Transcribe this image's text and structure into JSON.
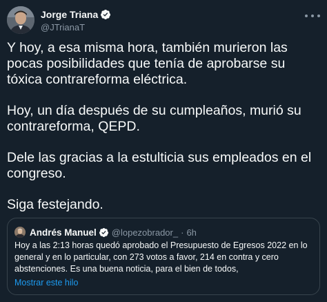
{
  "author": {
    "display_name": "Jorge Triana",
    "handle": "@JTrianaT",
    "verified_icon": "verified-badge-icon",
    "more_icon": "more-options-icon"
  },
  "body": {
    "paragraphs": [
      "Y hoy, a esa misma hora, también murieron las pocas posibilidades que tenía de aprobarse su tóxica contrareforma eléctrica.",
      "Hoy, un día después de su cumpleaños, murió su contrareforma, QEPD.",
      "Dele las gracias a la estulticia sus empleados en el congreso.",
      "Siga festejando."
    ]
  },
  "quoted_tweet": {
    "display_name": "Andrés Manuel",
    "handle": "@lopezobrador_",
    "separator": "·",
    "time": "6h",
    "text": "Hoy a las 2:13 horas quedó aprobado el Presupuesto de Egresos 2022 en lo general y en lo particular, con 273 votos a favor, 214 en contra y cero abstenciones. Es una buena noticia, para el bien de todos,",
    "show_thread_label": "Mostrar este hilo"
  },
  "colors": {
    "background": "#15202b",
    "text": "#f7f9f9",
    "secondary_text": "#8b98a5",
    "link": "#1d9bf0",
    "border": "#38444d",
    "verified": "#1d9bf0"
  }
}
